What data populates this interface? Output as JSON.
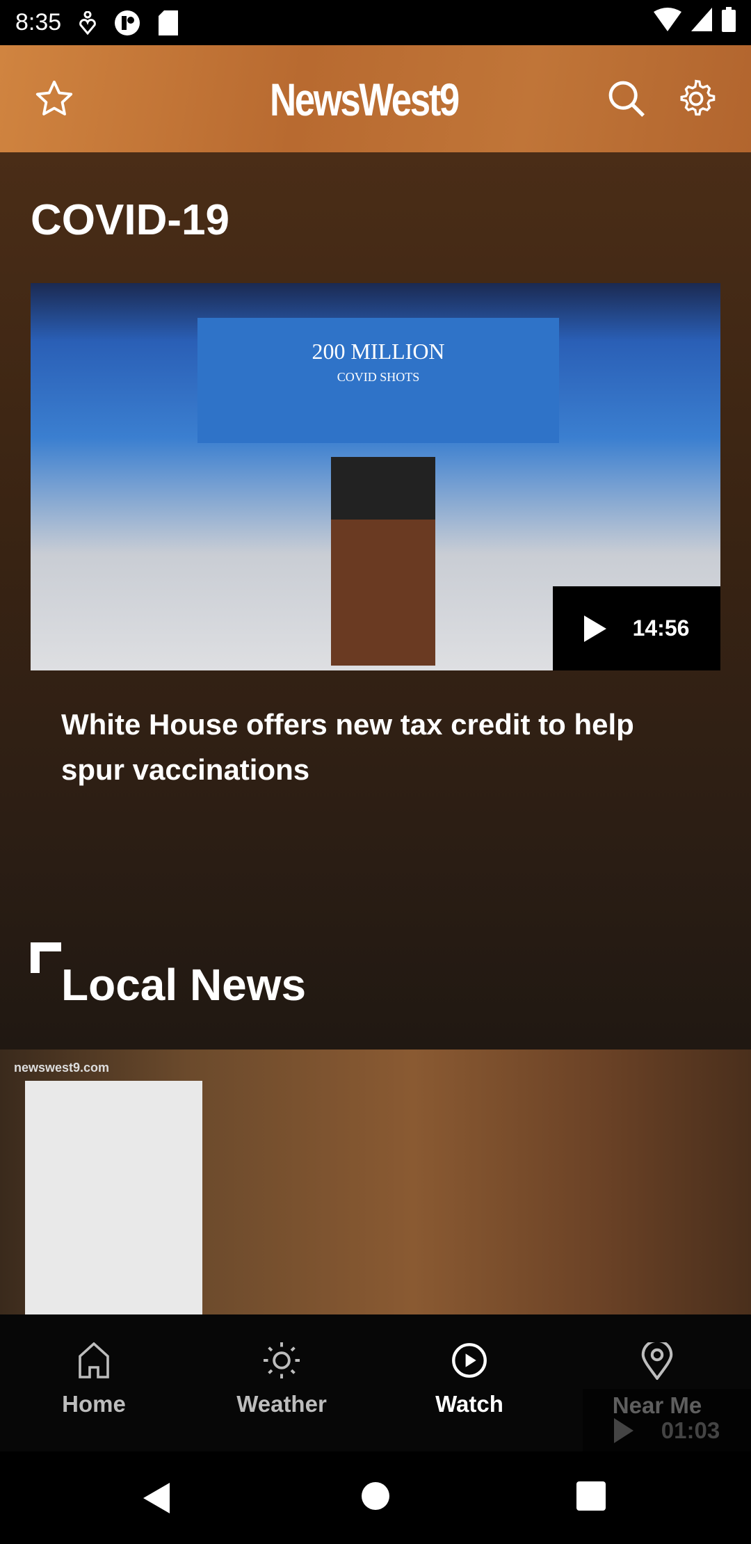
{
  "status_bar": {
    "time": "8:35"
  },
  "header": {
    "logo": "NewsWest9",
    "icons": [
      "star-icon",
      "search-icon",
      "gear-icon"
    ]
  },
  "covid_section": {
    "title": "COVID-19",
    "video": {
      "banner": "200 MILLION",
      "banner_sub": "COVID SHOTS",
      "duration": "14:56",
      "headline": "White House offers new tax credit to help spur vaccinations"
    }
  },
  "local_section": {
    "title": "Local News",
    "video": {
      "watermark": "newswest9.com",
      "duration": "01:03"
    }
  },
  "bottom_nav": {
    "items": [
      {
        "label": "Home",
        "icon": "home-icon"
      },
      {
        "label": "Weather",
        "icon": "sun-icon"
      },
      {
        "label": "Watch",
        "icon": "play-circle-icon",
        "active": true
      },
      {
        "label": "Near Me",
        "icon": "location-pin-icon"
      }
    ]
  },
  "colors": {
    "header": "#c07538",
    "active": "#ffffff",
    "inactive": "#bdbdbd"
  }
}
